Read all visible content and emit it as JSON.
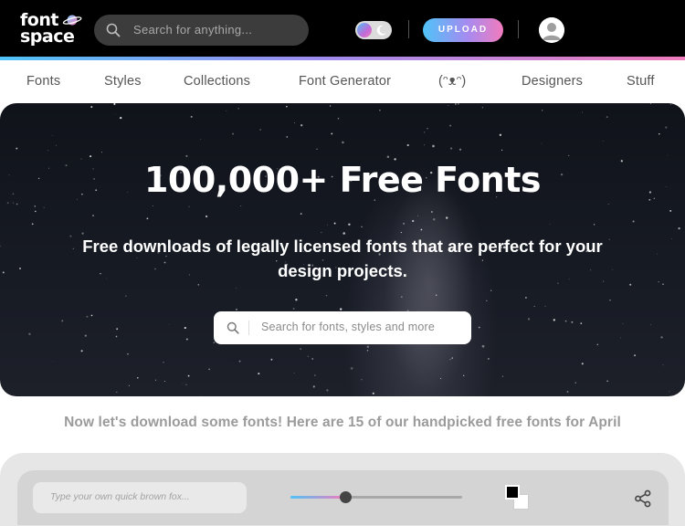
{
  "header": {
    "logo_line1": "font",
    "logo_line2": "space",
    "search_placeholder": "Search for anything...",
    "upload_label": "UPLOAD",
    "icons": {
      "search": "search-icon",
      "theme": "moon-icon",
      "avatar": "user-avatar-icon"
    }
  },
  "nav": {
    "items": [
      "Fonts",
      "Styles",
      "Collections",
      "Font Generator",
      "(ᵔᴥᵔ)",
      "Designers",
      "Stuff"
    ]
  },
  "hero": {
    "title": "100,000+ Free Fonts",
    "subtitle": "Free downloads of legally licensed fonts that are perfect for your design projects.",
    "search_placeholder": "Search for fonts, styles and more"
  },
  "tagline": "Now let's download some fonts! Here are 15 of our handpicked free fonts for April",
  "tool_panel": {
    "preview_placeholder": "Type your own quick brown fox...",
    "size_slider_level": 0.32,
    "foreground_color": "#000000",
    "background_color": "#ffffff",
    "share_icon": "share-icon"
  },
  "colors": {
    "accent_start": "#4fc3f7",
    "accent_mid": "#a58bf0",
    "accent_end": "#f27bbd",
    "header_bg": "#000000"
  }
}
